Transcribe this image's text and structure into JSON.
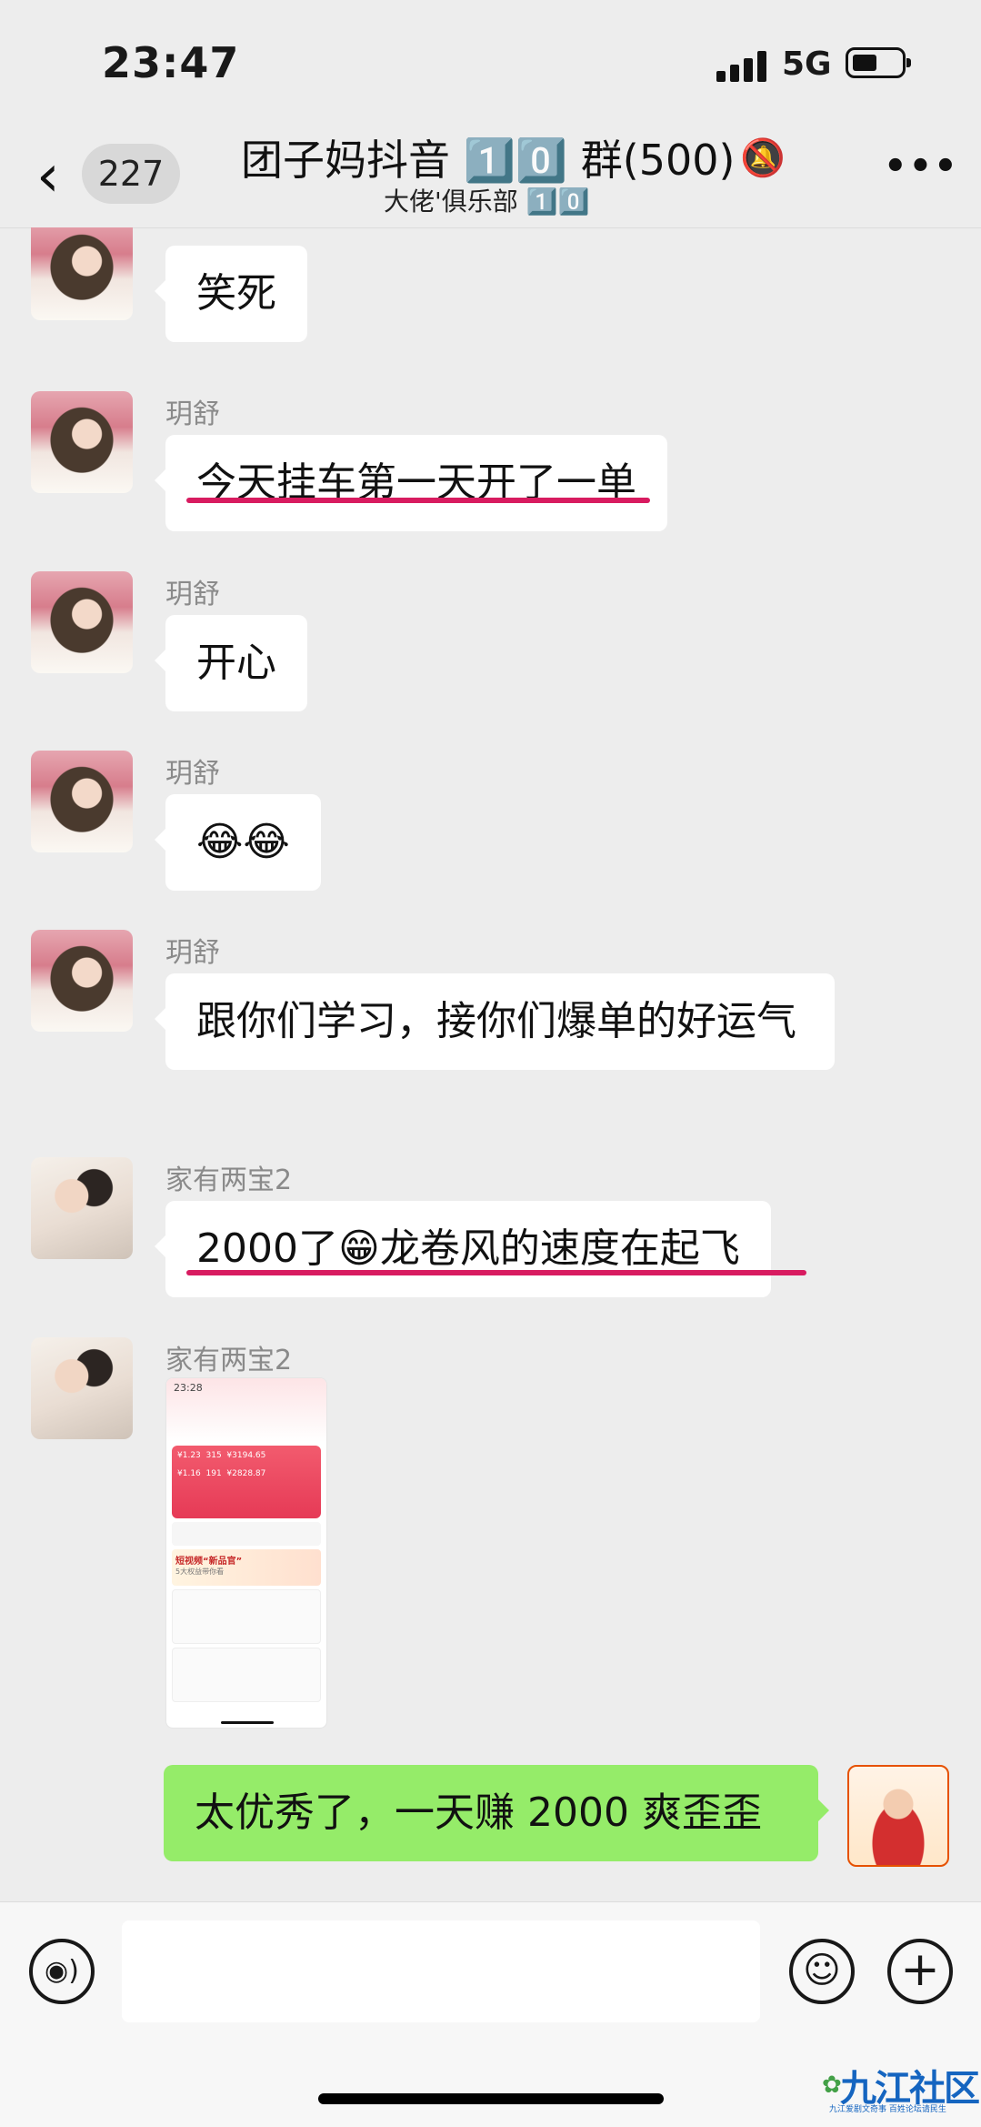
{
  "status_bar": {
    "time": "23:47",
    "network": "5G"
  },
  "header": {
    "back_count": "227",
    "title": "团子妈抖音 1️⃣0️⃣ 群(500)",
    "subtitle": "大佬'俱乐部 1️⃣0️⃣"
  },
  "messages": [
    {
      "sender": "",
      "text": "笑死"
    },
    {
      "sender": "玥舒",
      "text": "今天挂车第一天开了一单"
    },
    {
      "sender": "玥舒",
      "text": "开心"
    },
    {
      "sender": "玥舒",
      "text": "😂😂"
    },
    {
      "sender": "玥舒",
      "text": "跟你们学习，接你们爆单的好运气"
    },
    {
      "sender": "家有两宝2",
      "text": "2000了😁龙卷风的速度在起飞"
    },
    {
      "sender": "家有两宝2",
      "image": {
        "time": "23:28",
        "stats": [
          "¥1.23",
          "315",
          "¥3194.65",
          "¥1.16",
          "191",
          "¥2828.87"
        ],
        "promo": "短视频“新品官”",
        "promo_sub": "5大权益带你看"
      }
    },
    {
      "sender": "me",
      "text": "太优秀了，一天赚 2000 爽歪歪"
    }
  ],
  "watermark": {
    "text": "九江社区",
    "sub": "九江爱剧文奇事 百姓论坛请民生"
  },
  "colors": {
    "background": "#ededed",
    "bubble": "#ffffff",
    "my_bubble": "#95ec69",
    "underline": "#d81b60"
  }
}
